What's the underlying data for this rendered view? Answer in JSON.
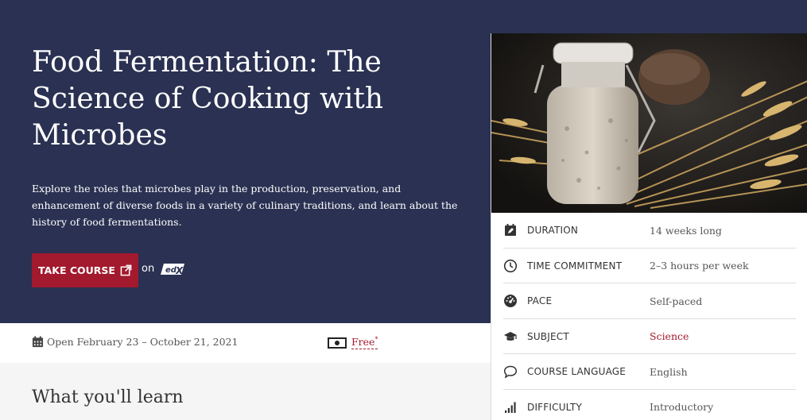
{
  "hero": {
    "title": "Food Fermentation: The Science of Cooking with Microbes",
    "description": "Explore the roles that microbes play in the production, preservation, and enhancement of diverse foods in a variety of culinary traditions, and learn about the history of food fermentations.",
    "take_course_label": "TAKE COURSE",
    "on_label": "on",
    "provider_logo": "edX",
    "background_color": "#2a3152",
    "button_color": "#a3192e"
  },
  "infobar": {
    "dates": "Open February 23 – October 21, 2021",
    "price": "Free",
    "price_marker": "*"
  },
  "section_title": "What you'll learn",
  "image": {
    "alt": "Jar of fermenting dough next to wheat stalks and bread"
  },
  "facts": [
    {
      "icon": "calendar-edit-icon",
      "label": "DURATION",
      "value": "14 weeks long",
      "link": false
    },
    {
      "icon": "clock-icon",
      "label": "TIME COMMITMENT",
      "value": "2–3 hours per week",
      "link": false
    },
    {
      "icon": "gauge-icon",
      "label": "PACE",
      "value": "Self-paced",
      "link": false
    },
    {
      "icon": "graduation-cap-icon",
      "label": "SUBJECT",
      "value": "Science",
      "link": true
    },
    {
      "icon": "speech-bubble-icon",
      "label": "COURSE LANGUAGE",
      "value": "English",
      "link": false
    },
    {
      "icon": "signal-bars-icon",
      "label": "DIFFICULTY",
      "value": "Introductory",
      "link": false
    }
  ]
}
